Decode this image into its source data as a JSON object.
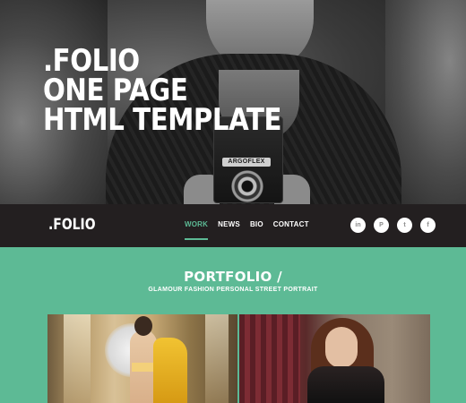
{
  "hero": {
    "title_lines": [
      ".FOLIO",
      "ONE PAGE",
      "HTML TEMPLATE"
    ],
    "camera_brand": "ARGOFLEX"
  },
  "nav": {
    "logo": ".FOLIO",
    "menu": [
      {
        "label": "WORK",
        "active": true
      },
      {
        "label": "NEWS",
        "active": false
      },
      {
        "label": "BIO",
        "active": false
      },
      {
        "label": "CONTACT",
        "active": false
      }
    ],
    "socials": [
      {
        "icon": "linkedin-icon",
        "glyph": "in"
      },
      {
        "icon": "pinterest-icon",
        "glyph": "P"
      },
      {
        "icon": "twitter-icon",
        "glyph": "t"
      },
      {
        "icon": "facebook-icon",
        "glyph": "f"
      }
    ]
  },
  "portfolio": {
    "title": "PORTFOLIO /",
    "subtitle": "GLAMOUR FASHION PERSONAL STREET PORTRAIT"
  },
  "colors": {
    "accent": "#5dba95",
    "nav_bg": "#231f20"
  }
}
